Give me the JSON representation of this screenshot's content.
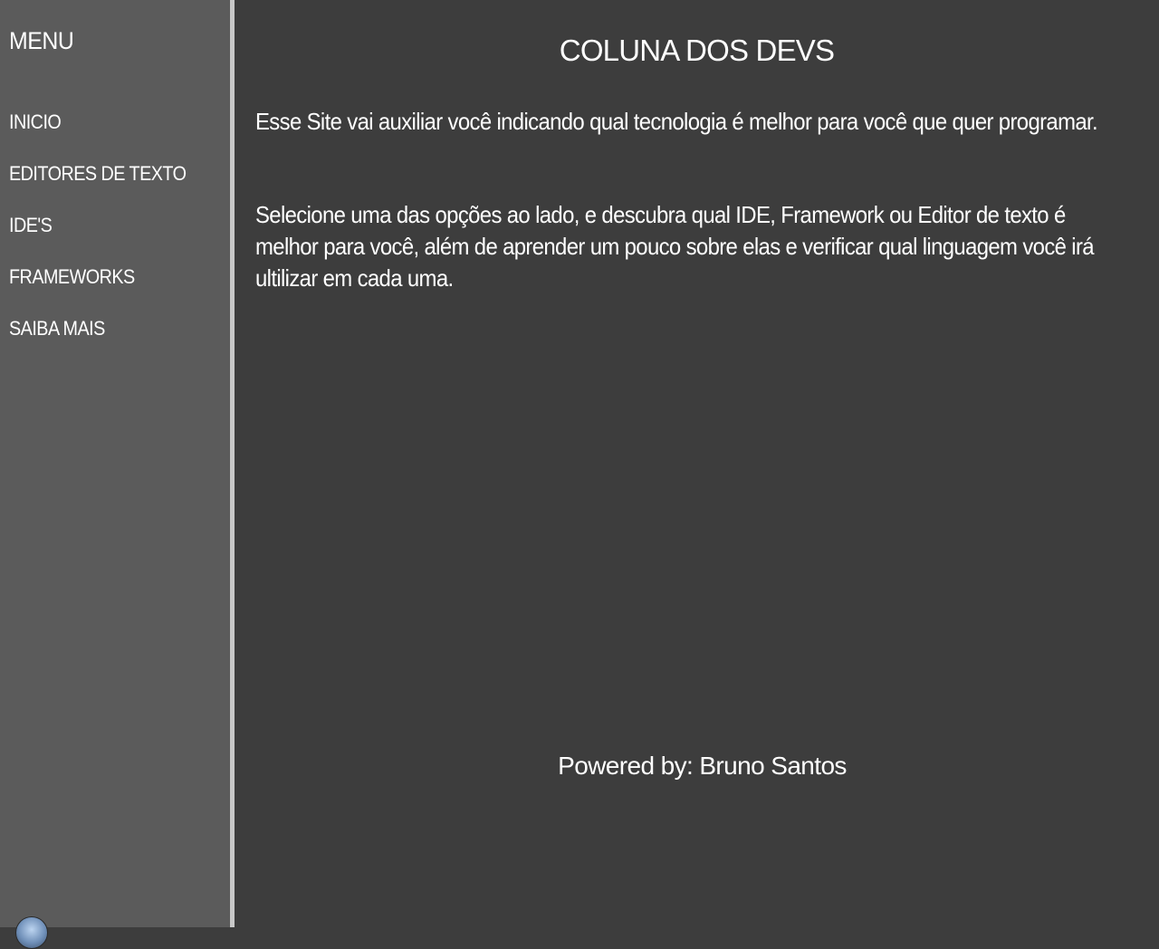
{
  "sidebar": {
    "title": "MENU",
    "items": [
      {
        "label": "INICIO"
      },
      {
        "label": "EDITORES DE TEXTO"
      },
      {
        "label": "IDE'S"
      },
      {
        "label": "FRAMEWORKS"
      },
      {
        "label": "SAIBA MAIS"
      }
    ]
  },
  "main": {
    "title": "COLUNA DOS DEVS",
    "paragraphs": [
      "Esse Site vai auxiliar você indicando qual tecnologia é melhor para você que quer programar.",
      "Selecione uma das opções ao lado, e descubra qual IDE, Framework ou Editor de texto é melhor para você, além de aprender um pouco sobre elas e verificar qual linguagem você irá ultilizar em cada uma."
    ],
    "footer": "Powered by: Bruno Santos"
  },
  "colors": {
    "sidebar_bg": "#5b5b5b",
    "content_bg": "#3d3d3d",
    "divider": "#c8c8c8",
    "text": "#ffffff"
  },
  "icons": {
    "bottom_left": "globe-icon"
  }
}
